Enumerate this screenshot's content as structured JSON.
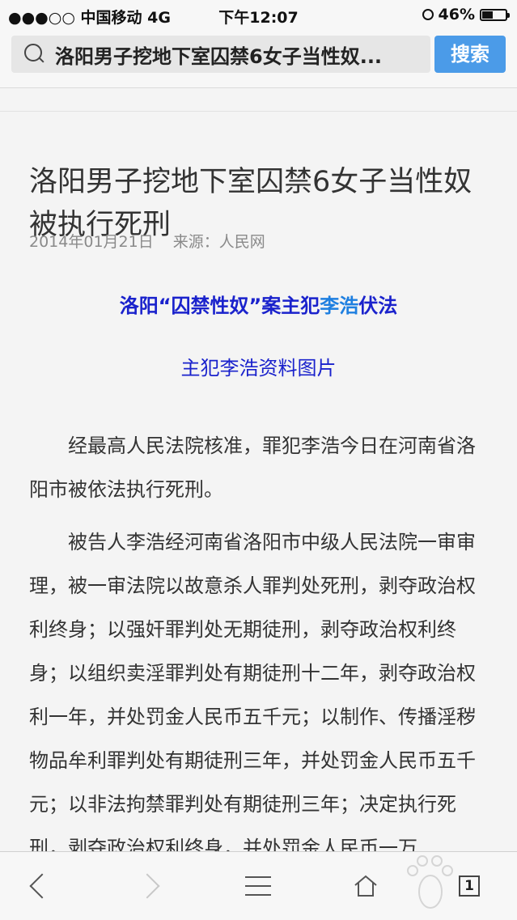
{
  "status_bar": {
    "carrier": "●●●○○ 中国移动   4G",
    "time": "下午12:07",
    "battery": "46%",
    "battery_level": 0.46
  },
  "search": {
    "query": "洛阳男子挖地下室囚禁6女子当性奴...",
    "button_label": "搜索"
  },
  "article": {
    "title": "洛阳男子挖地下室囚禁6女子当性奴 被执行死刑",
    "date": "2014年01月21日",
    "source": "来源：人民网",
    "subhead_before": "洛阳“囚禁性奴”案主犯",
    "subhead_name": "李浩",
    "subhead_after": "伏法",
    "image_caption": "主犯李浩资料图片",
    "paragraphs": [
      "经最高人民法院核准，罪犯李浩今日在河南省洛阳市被依法执行死刑。",
      "被告人李浩经河南省洛阳市中级人民法院一审审理，被一审法院以故意杀人罪判处死刑，剥夺政治权利终身；以强奸罪判处无期徒刑，剥夺政治权利终身；以组织卖淫罪判处有期徒刑十二年，剥夺政治权利一年，并处罚金人民币五千元；以制作、传播淫秽物品牟利罪判处有期徒刑三年，并处罚金人民币五千元；以非法拘禁罪判处有期徒刑三年；决定执行死刑，剥夺政治权利终身，并处罚金人民币一万"
    ]
  },
  "toolbar": {
    "tabs_count": "1",
    "icons": [
      "back-icon",
      "forward-icon",
      "menu-icon",
      "home-icon",
      "tabs-icon"
    ]
  },
  "colors": {
    "search_button": "#4b9be8",
    "subhead": "#1a22cc",
    "subhead_name": "#1e7fe0",
    "meta": "#8a8a8a"
  }
}
